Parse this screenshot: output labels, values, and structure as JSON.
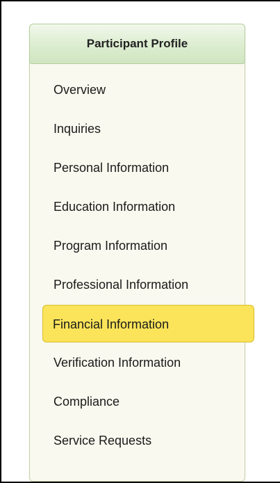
{
  "profile": {
    "title": "Participant Profile",
    "items": [
      {
        "label": "Overview"
      },
      {
        "label": "Inquiries"
      },
      {
        "label": "Personal Information"
      },
      {
        "label": "Education Information"
      },
      {
        "label": "Program Information"
      },
      {
        "label": "Professional Information"
      },
      {
        "label": "Financial Information",
        "active": true
      },
      {
        "label": "Verification Information"
      },
      {
        "label": "Compliance"
      },
      {
        "label": "Service Requests"
      }
    ],
    "colors": {
      "active_bg": "#fbe45a",
      "header_bg": "#deeed2",
      "panel_bg": "#f9f9ef"
    }
  }
}
